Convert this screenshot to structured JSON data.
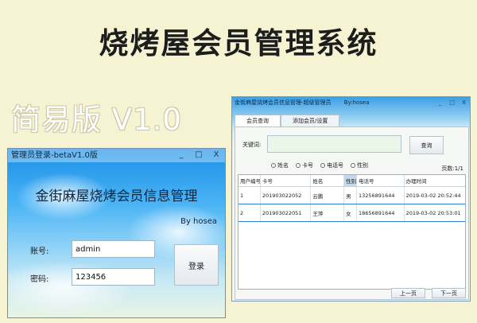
{
  "poster": {
    "title": "烧烤屋会员管理系统",
    "edition": "简易版 V1.0"
  },
  "login_window": {
    "title": "管理员登录-betaV1.0版",
    "controls": {
      "minimize": "_",
      "maximize": "□",
      "close": "X"
    },
    "header": "金街麻屋烧烤会员信息管理",
    "byline": "By hosea",
    "account_label": "账号:",
    "account_value": "admin",
    "password_label": "密码:",
    "password_value": "123456",
    "login_button": "登录"
  },
  "manager_window": {
    "title": "金街麻屋烧烤会员信息管理-超级管理员",
    "user": "By:hosea",
    "controls": {
      "minimize": "_",
      "maximize": "□",
      "close": "X"
    },
    "tabs": [
      {
        "label": "会员查询"
      },
      {
        "label": "添加会员/设置"
      }
    ],
    "keyword_label": "关键词:",
    "query_button": "查询",
    "radio_options": [
      {
        "label": "姓名"
      },
      {
        "label": "卡号"
      },
      {
        "label": "电话号"
      },
      {
        "label": "性别"
      }
    ],
    "page_info": "页数:1/1",
    "columns": [
      "用户编号",
      "卡号",
      "姓名",
      "性别",
      "电话号",
      "办理时间"
    ],
    "rows": [
      [
        "1",
        "201903022052",
        "云鹏",
        "男",
        "13256891644",
        "2019-03-02 20:52:44"
      ],
      [
        "2",
        "201903022051",
        "王萍",
        "女",
        "18656891644",
        "2019-03-02 20:53:01"
      ]
    ],
    "prev_button": "上一页",
    "next_button": "下一页"
  }
}
